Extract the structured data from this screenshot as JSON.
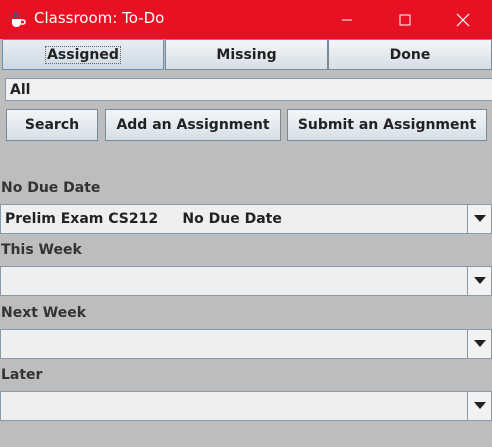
{
  "window": {
    "title": "Classroom: To-Do",
    "title_bar_color": "#e81123"
  },
  "tabs": [
    {
      "label": "Assigned",
      "selected": true
    },
    {
      "label": "Missing",
      "selected": false
    },
    {
      "label": "Done",
      "selected": false
    }
  ],
  "filter": {
    "selected_value": "All"
  },
  "actions": {
    "search_label": "Search",
    "add_label": "Add an Assignment",
    "submit_label": "Submit an Assignment"
  },
  "sections": [
    {
      "heading": "No Due Date",
      "selected_value": "Prelim Exam CS212     No Due Date"
    },
    {
      "heading": "This Week",
      "selected_value": ""
    },
    {
      "heading": "Next Week",
      "selected_value": ""
    },
    {
      "heading": "Later",
      "selected_value": ""
    }
  ],
  "icons": {
    "app": "java-cup-icon",
    "minimize": "minimize-icon",
    "maximize": "maximize-icon",
    "close": "close-icon",
    "dropdown": "chevron-down-icon"
  }
}
